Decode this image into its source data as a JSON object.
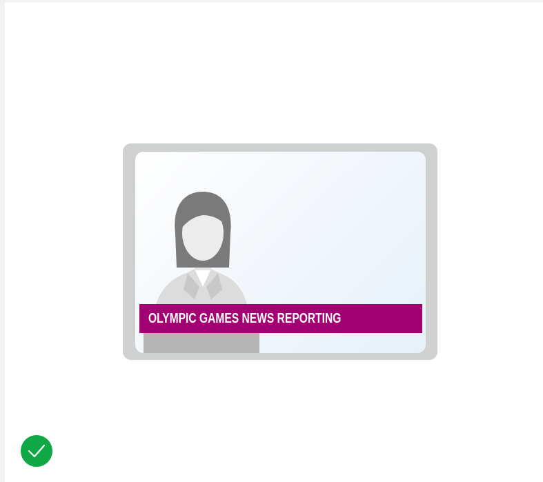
{
  "illustration": {
    "banner_text": "OLYMPIC GAMES NEWS REPORTING",
    "banner_color": "#a20073",
    "frame_color": "#cfd0d0",
    "icons": [
      "news-anchor-icon"
    ]
  },
  "status": {
    "icon": "checkmark-icon",
    "color": "#10a845"
  }
}
